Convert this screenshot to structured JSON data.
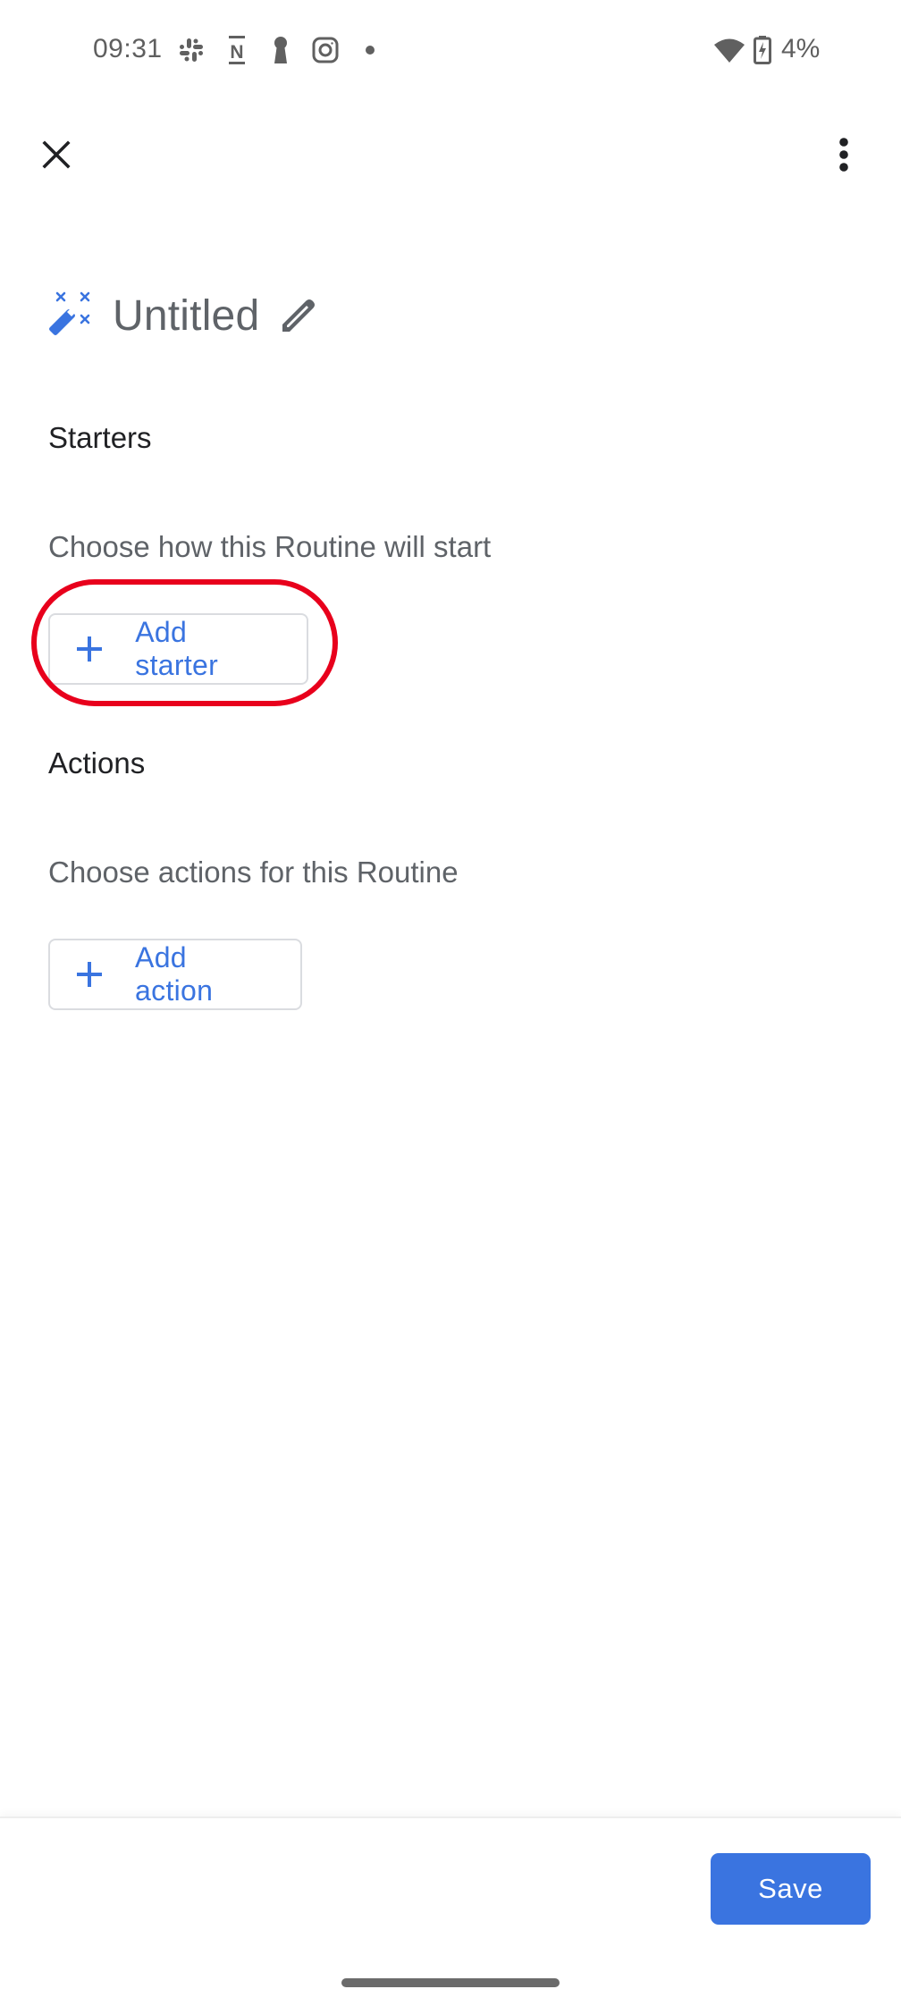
{
  "status_bar": {
    "time": "09:31",
    "notification_icons": [
      "slack-icon",
      "notion-icon",
      "keyhole-icon",
      "instagram-icon",
      "more-dot-icon"
    ],
    "wifi": "wifi-icon",
    "battery_icon": "battery-charging-icon",
    "battery_percent": "4%"
  },
  "app_bar": {
    "close_icon": "close-icon",
    "overflow_icon": "more-vert-icon"
  },
  "routine": {
    "title": "Untitled",
    "title_icon": "magic-wand-icon",
    "edit_icon": "pencil-icon"
  },
  "starters": {
    "heading": "Starters",
    "description": "Choose how this Routine will start",
    "add_button_label": "Add starter",
    "highlighted": true
  },
  "actions": {
    "heading": "Actions",
    "description": "Choose actions for this Routine",
    "add_button_label": "Add action"
  },
  "footer": {
    "save_label": "Save"
  },
  "colors": {
    "accent": "#3a74e0",
    "highlight": "#e8001c",
    "secondary_text": "#5f6368",
    "primary_text": "#202124"
  }
}
